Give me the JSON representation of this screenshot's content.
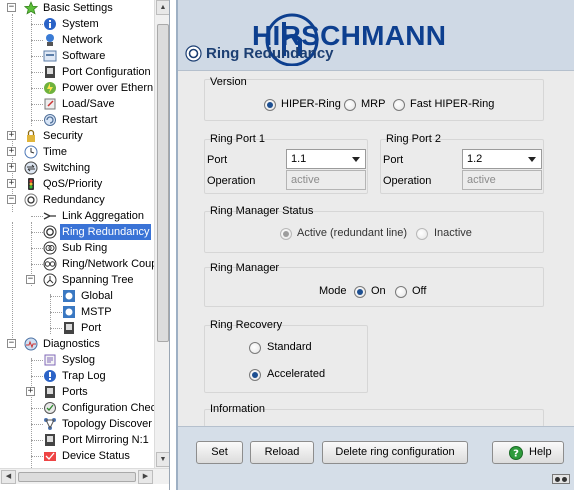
{
  "tree": {
    "items": [
      {
        "label": "Basic Settings",
        "icon": "star-icon",
        "expander": "−"
      },
      {
        "label": "System",
        "icon": "info-icon"
      },
      {
        "label": "Network",
        "icon": "network-icon"
      },
      {
        "label": "Software",
        "icon": "software-icon"
      },
      {
        "label": "Port Configuration",
        "icon": "port-icon"
      },
      {
        "label": "Power over Ethern",
        "icon": "poe-icon"
      },
      {
        "label": "Load/Save",
        "icon": "load-save-icon"
      },
      {
        "label": "Restart",
        "icon": "restart-icon"
      },
      {
        "label": "Security",
        "icon": "lock-icon",
        "expander": "+"
      },
      {
        "label": "Time",
        "icon": "clock-icon",
        "expander": "+"
      },
      {
        "label": "Switching",
        "icon": "switching-icon",
        "expander": "+"
      },
      {
        "label": "QoS/Priority",
        "icon": "qos-icon",
        "expander": "+"
      },
      {
        "label": "Redundancy",
        "icon": "redundancy-icon",
        "expander": "−"
      },
      {
        "label": "Link Aggregation",
        "icon": "link-aggregation-icon"
      },
      {
        "label": "Ring Redundancy",
        "icon": "ring-icon"
      },
      {
        "label": "Sub Ring",
        "icon": "sub-ring-icon"
      },
      {
        "label": "Ring/Network Coup",
        "icon": "ring-coupling-icon"
      },
      {
        "label": "Spanning Tree",
        "icon": "spanning-tree-icon",
        "expander": "−"
      },
      {
        "label": "Global",
        "icon": "global-icon"
      },
      {
        "label": "MSTP",
        "icon": "mstp-icon"
      },
      {
        "label": "Port",
        "icon": "port-icon"
      },
      {
        "label": "Diagnostics",
        "icon": "diagnostics-icon",
        "expander": "−"
      },
      {
        "label": "Syslog",
        "icon": "syslog-icon"
      },
      {
        "label": "Trap Log",
        "icon": "trap-log-icon"
      },
      {
        "label": "Ports",
        "icon": "port-icon",
        "expander": "+"
      },
      {
        "label": "Configuration Chec",
        "icon": "config-check-icon"
      },
      {
        "label": "Topology Discover",
        "icon": "topology-icon"
      },
      {
        "label": "Port Mirroring N:1",
        "icon": "mirroring-icon"
      },
      {
        "label": "Device Status",
        "icon": "device-status-icon"
      }
    ],
    "selected_index": 14
  },
  "header": {
    "title": "Ring Redundancy",
    "brand": "HIRSCHMANN",
    "brand_color": "#0d3f8f"
  },
  "version": {
    "title": "Version",
    "options": [
      "HIPER-Ring",
      "MRP",
      "Fast HIPER-Ring"
    ],
    "selected": "HIPER-Ring"
  },
  "ring_port_1": {
    "title": "Ring Port 1",
    "port_label": "Port",
    "port_value": "1.1",
    "operation_label": "Operation",
    "operation_value": "active"
  },
  "ring_port_2": {
    "title": "Ring Port 2",
    "port_label": "Port",
    "port_value": "1.2",
    "operation_label": "Operation",
    "operation_value": "active"
  },
  "ring_manager_status": {
    "title": "Ring Manager Status",
    "options": [
      "Active (redundant line)",
      "Inactive"
    ],
    "selected": "Active (redundant line)"
  },
  "ring_manager": {
    "title": "Ring Manager",
    "mode_label": "Mode",
    "options": [
      "On",
      "Off"
    ],
    "selected": "On"
  },
  "ring_recovery": {
    "title": "Ring Recovery",
    "options": [
      "Standard",
      "Accelerated"
    ],
    "selected": "Accelerated"
  },
  "information": {
    "title": "Information"
  },
  "footer": {
    "set_label": "Set",
    "reload_label": "Reload",
    "delete_label": "Delete ring configuration",
    "help_label": "Help"
  },
  "colors": {
    "accent": "#3a73d6",
    "title": "#1c3f73",
    "panel_bg": "#ebebeb",
    "header_bg": "#cfd9e5"
  }
}
